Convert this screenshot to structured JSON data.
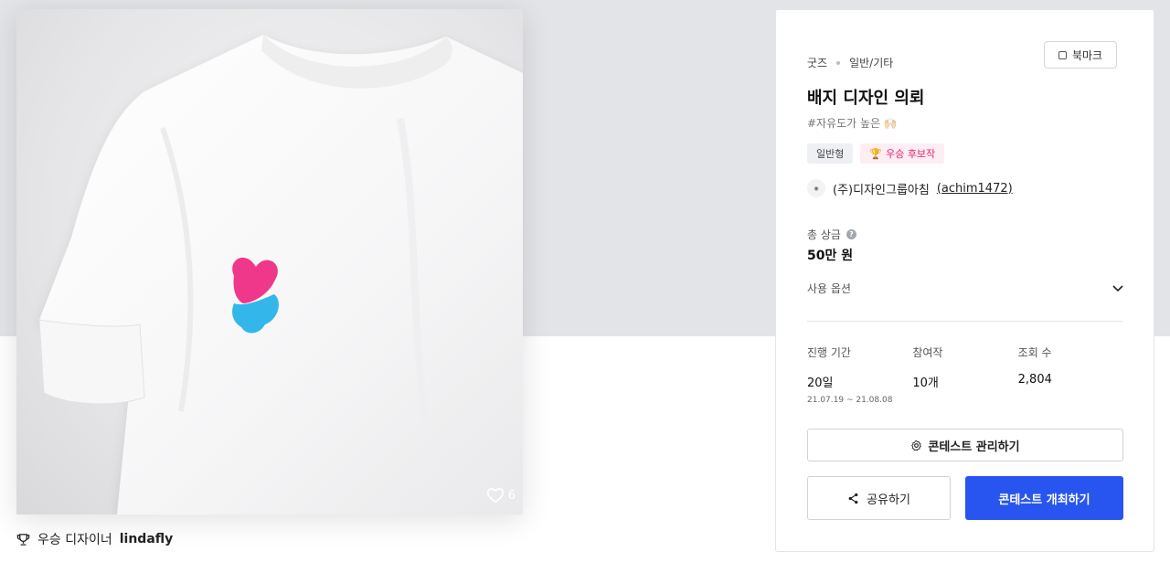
{
  "gallery": {
    "like_count": "6",
    "winner_prefix": "우승 디자이너",
    "winner_name": "lindafly"
  },
  "panel": {
    "category": "굿즈",
    "subcategory": "일반/기타",
    "bookmark_label": "북마크",
    "title": "배지 디자인 의뢰",
    "subtitle": "#자유도가 높은 🙌🏻",
    "badges": {
      "type": "일반형",
      "candidate": "우승 후보작"
    },
    "host": {
      "name": "(주)디자인그룹아침",
      "id": "(achim1472)"
    },
    "prize_label": "총 상금",
    "prize_value": "50만 원",
    "options_label": "사용 옵션",
    "stats": {
      "period_label": "진행 기간",
      "period_value": "20일",
      "period_dates": "21.07.19 ~ 21.08.08",
      "participants_label": "참여작",
      "participants_value": "10개",
      "views_label": "조회 수",
      "views_value": "2,804"
    },
    "manage_label": "콘테스트 관리하기",
    "share_label": "공유하기",
    "host_contest_label": "콘테스트 개최하기"
  },
  "colors": {
    "primary": "#2855f0",
    "candidate_badge": "#e0266f",
    "pin_pink": "#f0388a",
    "pin_blue": "#33b7ea"
  }
}
